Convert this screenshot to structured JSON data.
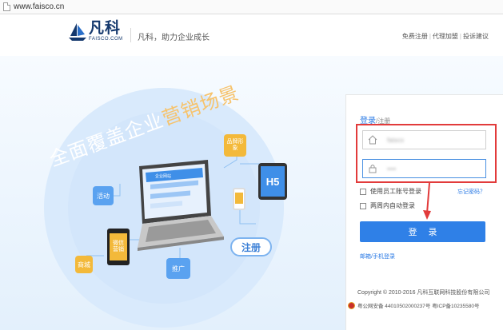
{
  "browser": {
    "url": "www.faisco.cn"
  },
  "header": {
    "logo_name": "凡科",
    "logo_sub": "FAISCO.COM",
    "slogan": "凡科，助力企业成长",
    "links": [
      "免费注册",
      "代理加盟",
      "投诉建议"
    ]
  },
  "banner": {
    "headline_part1": "全面覆盖企业",
    "headline_part2": "营销场景",
    "tags": {
      "activity": "活动",
      "brand": "品牌形象",
      "mall": "商城",
      "promote": "推广",
      "register": "注册",
      "wechat": "微信营销",
      "h5": "H5",
      "site": "企业网站"
    }
  },
  "login": {
    "tab_login": "登录",
    "tab_register": "/注册",
    "username_value": "faisco",
    "password_value": "••••",
    "staff_login_label": "使用员工账号登录",
    "forgot_label": "忘记密码？",
    "auto_login_label": "两周内自动登录",
    "submit_label": "登录",
    "alt_login": "邮箱/手机登录"
  },
  "footer": {
    "copyright": "Copyright © 2010-2016 凡科互联网科技股份有限公司",
    "icp": "粤公网安备 44010502000237号  粤ICP备10235580号"
  },
  "colors": {
    "accent": "#2f80e7",
    "highlight_box": "#e23b3b",
    "brand": "#14386d"
  }
}
